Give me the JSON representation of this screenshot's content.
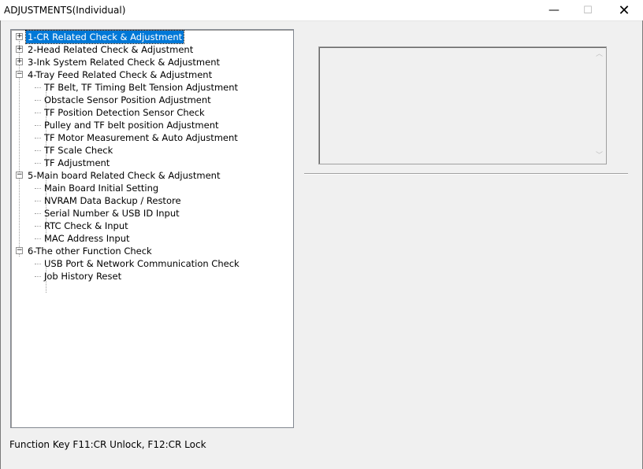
{
  "window": {
    "title": "ADJUSTMENTS(Individual)",
    "minimize_symbol": "—",
    "maximize_symbol": "☐",
    "close_symbol": "✕"
  },
  "tree": {
    "items": [
      {
        "label": "1-CR Related Check & Adjustment",
        "expander": "+",
        "selected": true
      },
      {
        "label": "2-Head Related Check & Adjustment",
        "expander": "+"
      },
      {
        "label": "3-Ink System Related Check & Adjustment",
        "expander": "+"
      },
      {
        "label": "4-Tray Feed Related Check & Adjustment",
        "expander": "−"
      },
      {
        "label": "TF Belt, TF Timing Belt Tension Adjustment"
      },
      {
        "label": "Obstacle Sensor Position Adjustment"
      },
      {
        "label": "TF Position Detection Sensor Check"
      },
      {
        "label": "Pulley and TF belt position Adjustment"
      },
      {
        "label": "TF Motor Measurement & Auto Adjustment"
      },
      {
        "label": "TF Scale Check"
      },
      {
        "label": "TF Adjustment"
      },
      {
        "label": "5-Main board Related Check & Adjustment",
        "expander": "−"
      },
      {
        "label": "Main Board Initial Setting"
      },
      {
        "label": "NVRAM Data Backup / Restore"
      },
      {
        "label": "Serial Number & USB ID Input"
      },
      {
        "label": "RTC Check & Input"
      },
      {
        "label": "MAC Address Input"
      },
      {
        "label": "6-The other Function Check",
        "expander": "−"
      },
      {
        "label": "USB Port & Network Communication Check"
      },
      {
        "label": "Job History Reset"
      }
    ]
  },
  "memo": {
    "scroll_up": "︿",
    "scroll_down": "﹀"
  },
  "footer": {
    "text": "Function Key F11:CR Unlock, F12:CR Lock"
  },
  "colors": {
    "selection": "#0078d7",
    "background": "#f0f0f0"
  }
}
